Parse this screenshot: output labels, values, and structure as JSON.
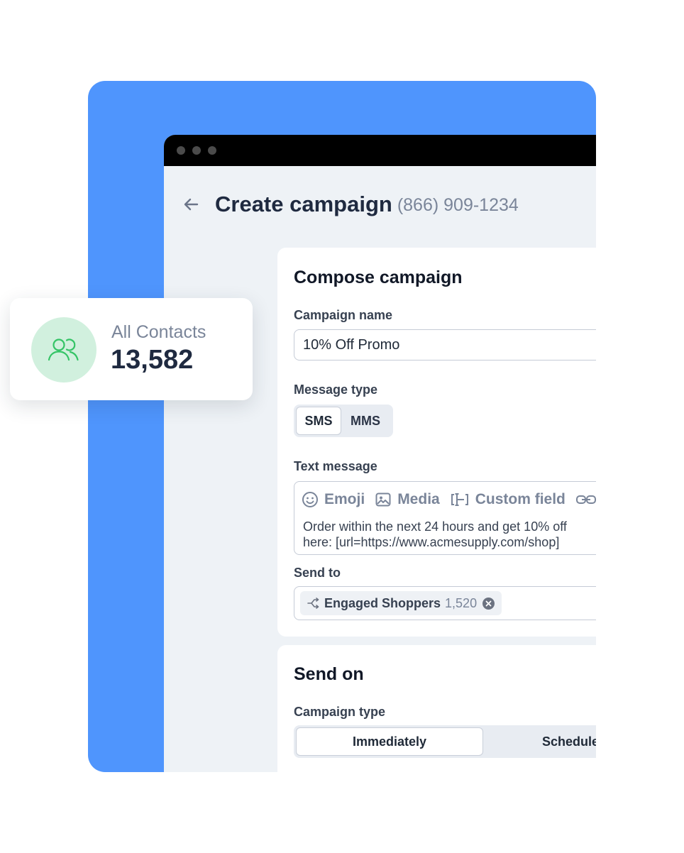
{
  "header": {
    "title": "Create campaign",
    "phone": "(866) 909-1234"
  },
  "compose": {
    "title": "Compose campaign",
    "campaign_name_label": "Campaign name",
    "campaign_name_value": "10% Off Promo",
    "message_type_label": "Message type",
    "message_type_options": [
      "SMS",
      "MMS"
    ],
    "message_type_selected": "SMS",
    "text_message_label": "Text message",
    "toolbar": {
      "emoji": "Emoji",
      "media": "Media",
      "custom_field": "Custom field"
    },
    "message_line1": "Order within the next 24 hours and get 10% off",
    "message_line2": "here: [url=https://www.acmesupply.com/shop]",
    "send_to_label": "Send to",
    "send_to_chip": {
      "label": "Engaged Shoppers",
      "count": "1,520"
    }
  },
  "send_on": {
    "title": "Send on",
    "campaign_type_label": "Campaign type",
    "options": [
      "Immediately",
      "Schedule"
    ],
    "selected": "Immediately"
  },
  "contacts": {
    "label": "All Contacts",
    "count": "13,582"
  },
  "colors": {
    "brand_blue": "#4f95fd",
    "contact_icon_green": "#34c466",
    "contact_icon_bg": "#d1f0de"
  }
}
